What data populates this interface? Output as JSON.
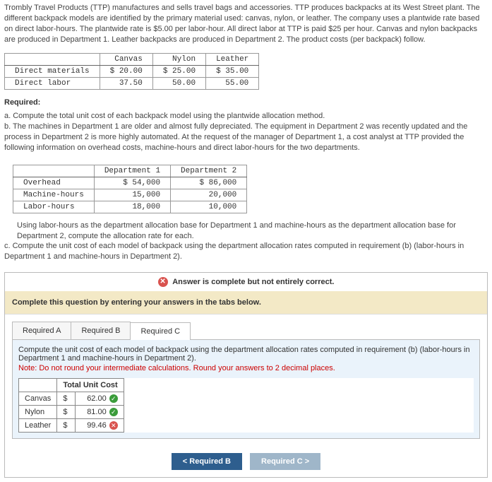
{
  "intro": "Trombly Travel Products (TTP) manufactures and sells travel bags and accessories. TTP produces backpacks at its West Street plant. The different backpack models are identified by the primary material used: canvas, nylon, or leather. The company uses a plantwide rate based on direct labor-hours. The plantwide rate is $5.00 per labor-hour. All direct labor at TTP is paid $25 per hour. Canvas and nylon backpacks are produced in Department 1. Leather backpacks are produced in Department 2. The product costs (per backpack) follow.",
  "cost_table": {
    "headers": [
      "",
      "Canvas",
      "Nylon",
      "Leather"
    ],
    "rows": [
      {
        "label": "Direct materials",
        "canvas": "$ 20.00",
        "nylon": "$ 25.00",
        "leather": "$ 35.00"
      },
      {
        "label": "Direct labor",
        "canvas": "37.50",
        "nylon": "50.00",
        "leather": "55.00"
      }
    ]
  },
  "required_label": "Required:",
  "req_a": "a. Compute the total unit cost of each backpack model using the plantwide allocation method.",
  "req_b": "b. The machines in Department 1 are older and almost fully depreciated. The equipment in Department 2 was recently updated and the process in Department 2 is more highly automated. At the request of the manager of Department 1, a cost analyst at TTP provided the following information on overhead costs, machine-hours and direct labor-hours for the two departments.",
  "dept_table": {
    "headers": [
      "",
      "Department 1",
      "Department 2"
    ],
    "rows": [
      {
        "label": "Overhead",
        "d1": "$ 54,000",
        "d2": "$ 86,000"
      },
      {
        "label": "Machine-hours",
        "d1": "15,000",
        "d2": "20,000"
      },
      {
        "label": "Labor-hours",
        "d1": "18,000",
        "d2": "10,000"
      }
    ]
  },
  "req_b2": "Using labor-hours as the department allocation base for Department 1 and machine-hours as the department allocation base for Department 2, compute the allocation rate for each.",
  "req_c": "c. Compute the unit cost of each model of backpack using the department allocation rates computed in requirement (b) (labor-hours in Department 1 and machine-hours in Department 2).",
  "status": "Answer is complete but not entirely correct.",
  "complete_instruction": "Complete this question by entering your answers in the tabs below.",
  "tabs": {
    "a": "Required A",
    "b": "Required B",
    "c": "Required C"
  },
  "tabc": {
    "instruction": "Compute the unit cost of each model of backpack using the department allocation rates computed in requirement (b) (labor-hours in Department 1 and machine-hours in Department 2).",
    "note": "Note: Do not round your intermediate calculations. Round your answers to 2 decimal places.",
    "header": "Total Unit Cost",
    "rows": [
      {
        "label": "Canvas",
        "cur": "$",
        "val": "62.00",
        "mark": "ok"
      },
      {
        "label": "Nylon",
        "cur": "$",
        "val": "81.00",
        "mark": "ok"
      },
      {
        "label": "Leather",
        "cur": "$",
        "val": "99.46",
        "mark": "bad"
      }
    ]
  },
  "nav": {
    "prev": "Required B",
    "next": "Required C"
  },
  "glyphs": {
    "chev_left": "<",
    "chev_right": ">",
    "x": "✕",
    "check": "✓"
  }
}
